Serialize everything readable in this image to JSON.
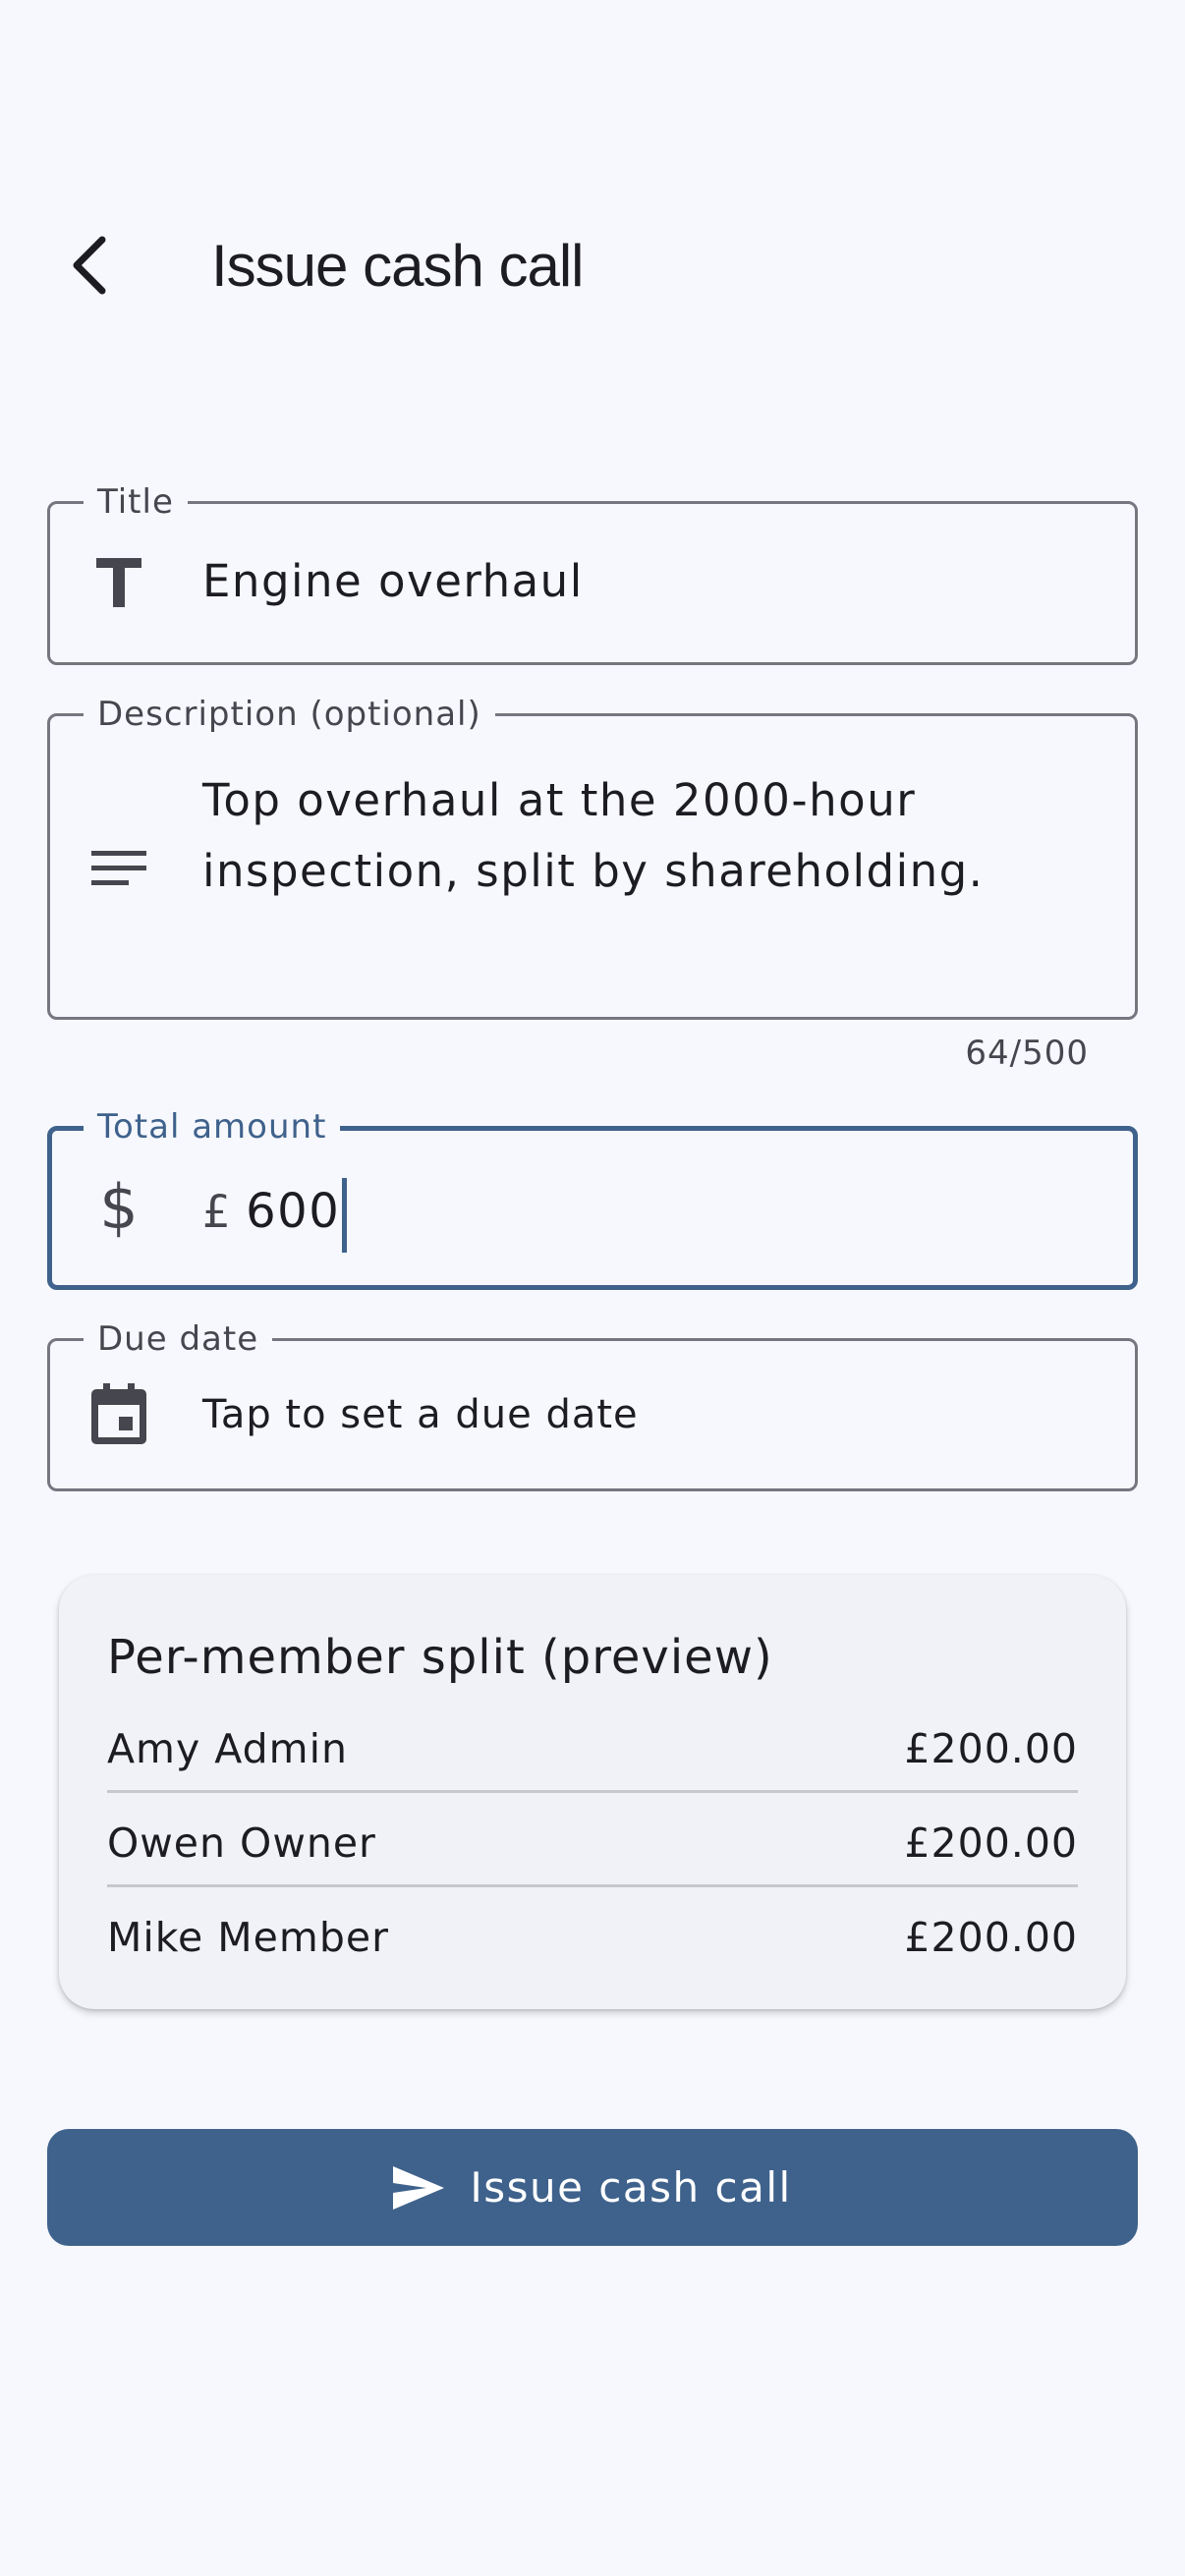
{
  "header": {
    "title": "Issue cash call",
    "back_icon": "chevron-left-icon"
  },
  "form": {
    "title": {
      "label": "Title",
      "value": "Engine overhaul",
      "icon": "text-format-icon"
    },
    "description": {
      "label": "Description (optional)",
      "line1": "Top overhaul at the 2000-hour",
      "line2": "inspection, split by shareholding.",
      "counter": "64/500",
      "icon": "notes-icon"
    },
    "total_amount": {
      "label": "Total amount",
      "prefix": "£",
      "value": "600",
      "icon": "dollar-icon",
      "accent": "#3f628c"
    },
    "due_date": {
      "label": "Due date",
      "placeholder": "Tap to set a due date",
      "icon": "calendar-icon"
    }
  },
  "split_preview": {
    "title": "Per-member split (preview)",
    "members": [
      {
        "name": "Amy Admin",
        "amount": "£200.00"
      },
      {
        "name": "Owen Owner",
        "amount": "£200.00"
      },
      {
        "name": "Mike Member",
        "amount": "£200.00"
      }
    ]
  },
  "submit": {
    "label": "Issue cash call",
    "icon": "send-icon",
    "color": "#3f628c"
  }
}
